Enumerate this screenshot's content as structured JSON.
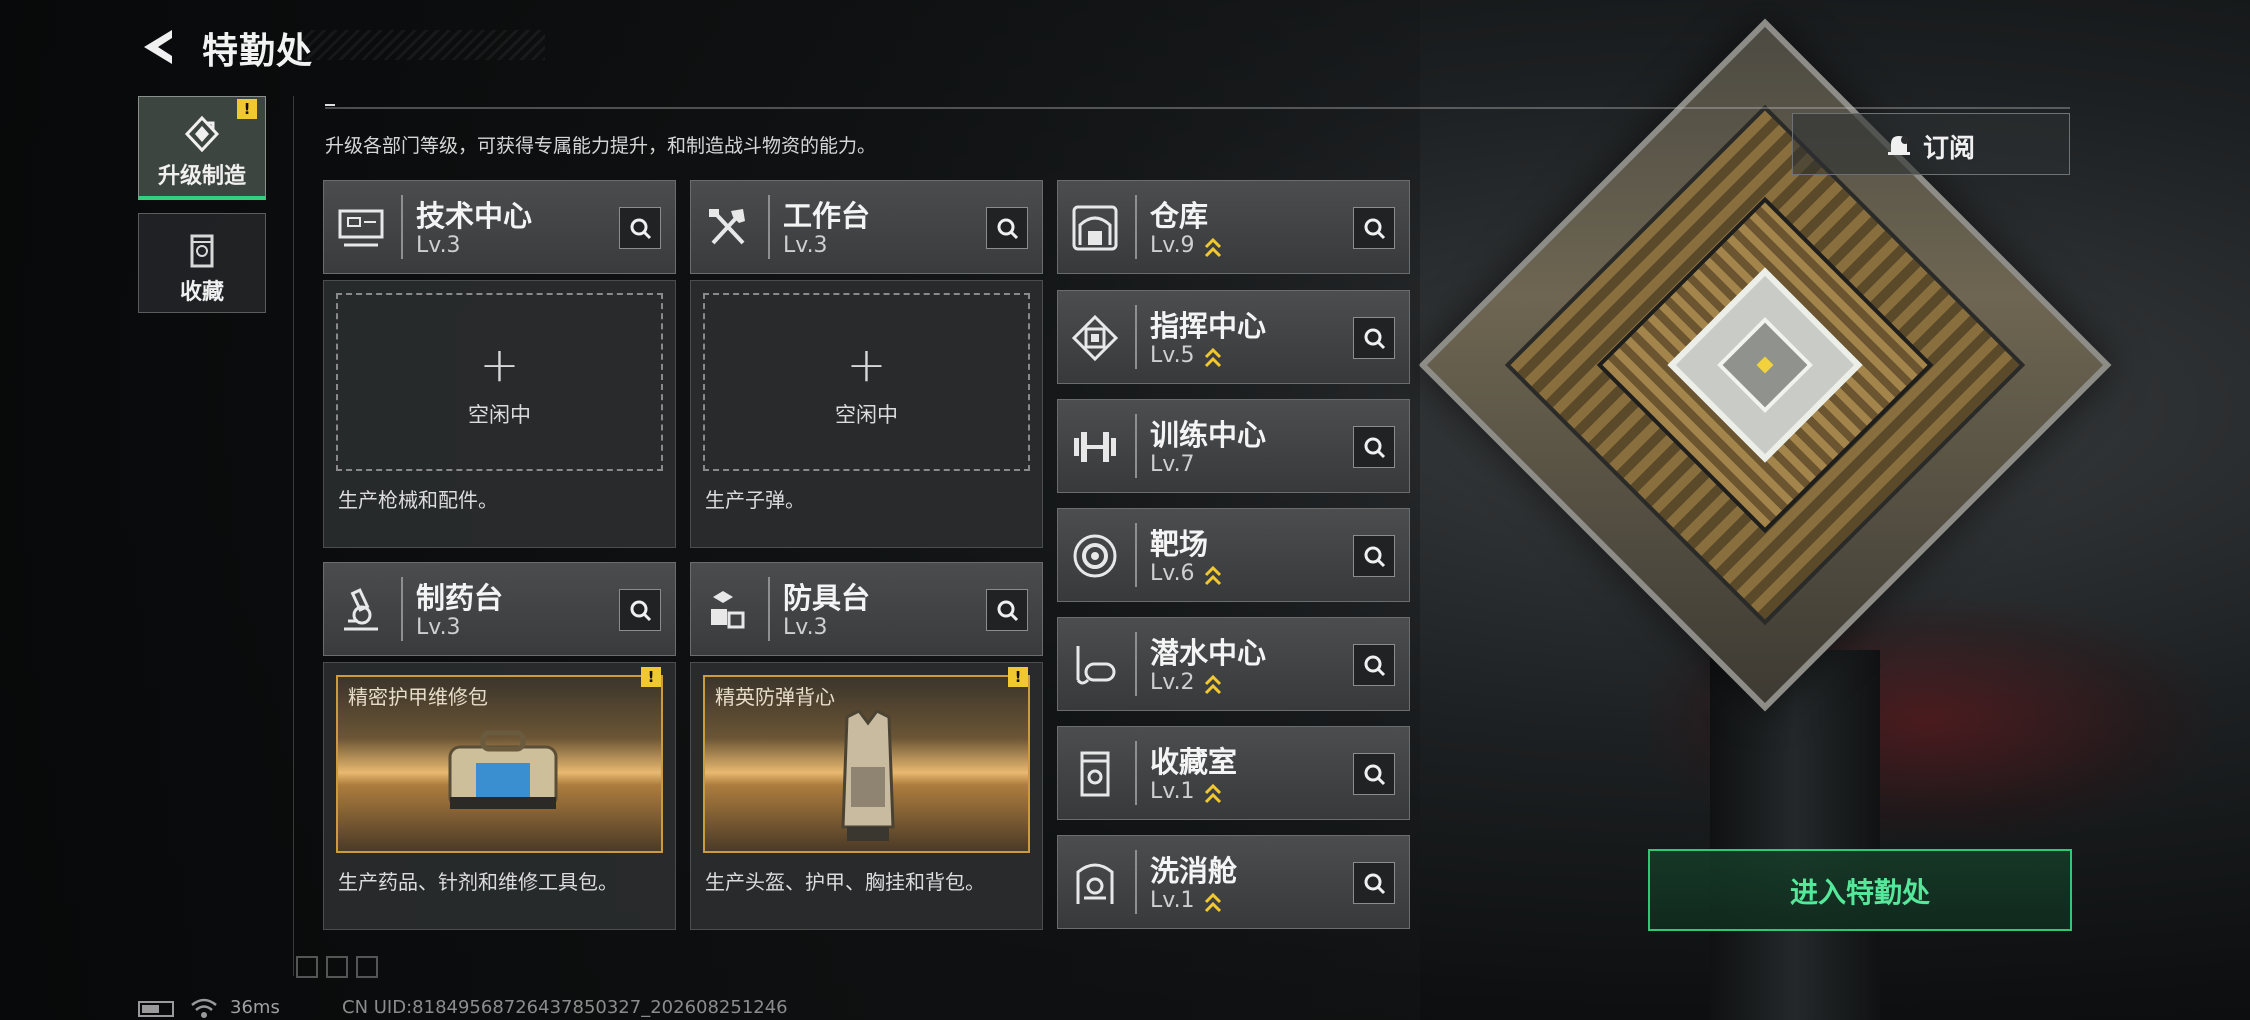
{
  "header": {
    "title": "特勤处",
    "subtitle": "升级各部门等级，可获得专属能力提升，和制造战斗物资的能力。"
  },
  "side_tabs": [
    {
      "label": "升级制造",
      "badge": "!"
    },
    {
      "label": "收藏"
    }
  ],
  "production_cards": [
    {
      "name": "技术中心",
      "level": "Lv.3",
      "idle_label": "空闲中",
      "plus": "+",
      "description": "生产枪械和配件。"
    },
    {
      "name": "工作台",
      "level": "Lv.3",
      "idle_label": "空闲中",
      "plus": "+",
      "description": "生产子弹。"
    },
    {
      "name": "制药台",
      "level": "Lv.3",
      "item_name": "精密护甲维修包",
      "badge": "!",
      "description": "生产药品、针剂和维修工具包。"
    },
    {
      "name": "防具台",
      "level": "Lv.3",
      "item_name": "精英防弹背心",
      "badge": "!",
      "description": "生产头盔、护甲、胸挂和背包。"
    }
  ],
  "facilities": [
    {
      "name": "仓库",
      "level": "Lv.9",
      "upgradable": true
    },
    {
      "name": "指挥中心",
      "level": "Lv.5",
      "upgradable": true
    },
    {
      "name": "训练中心",
      "level": "Lv.7",
      "upgradable": false
    },
    {
      "name": "靶场",
      "level": "Lv.6",
      "upgradable": true
    },
    {
      "name": "潜水中心",
      "level": "Lv.2",
      "upgradable": true
    },
    {
      "name": "收藏室",
      "level": "Lv.1",
      "upgradable": true
    },
    {
      "name": "洗消舱",
      "level": "Lv.1",
      "upgradable": true
    }
  ],
  "subscribe": {
    "label": "订阅"
  },
  "enter_button": {
    "label": "进入特勤处"
  },
  "status": {
    "latency": "36ms",
    "uid": "CN UID:81849568726437850327_202608251246",
    "battery_level": 0.6
  },
  "colors": {
    "accent_green": "#2ec877",
    "warning_yellow": "#f2c830",
    "upgrade_arrow": "#f2c830",
    "item_border": "#cc9b3d"
  },
  "icons": {
    "back": "back-chevron-icon",
    "search": "search-icon",
    "subscribe": "bell-icon",
    "upgrade": "double-chevron-up-icon"
  }
}
